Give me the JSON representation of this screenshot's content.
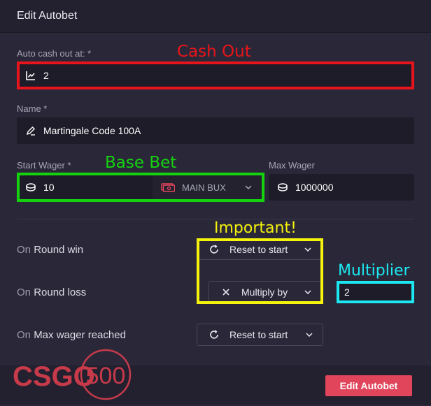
{
  "header": {
    "title": "Edit Autobet"
  },
  "form": {
    "cashout": {
      "label": "Auto cash out at: *",
      "value": "2",
      "icon": "chart-line-icon"
    },
    "name": {
      "label": "Name *",
      "value": "Martingale Code 100A",
      "icon": "pencil-icon"
    },
    "start_wager": {
      "label": "Start Wager *",
      "value": "10",
      "icon": "coin-icon",
      "currency": "MAIN BUX",
      "currency_icon": "cash-stack-icon"
    },
    "max_wager": {
      "label": "Max Wager",
      "value": "1000000",
      "icon": "coin-icon"
    }
  },
  "rules": {
    "round_win": {
      "prefix": "On",
      "event": "Round win",
      "action": "Reset to start",
      "icon": "reset-icon"
    },
    "round_loss": {
      "prefix": "On",
      "event": "Round loss",
      "action": "Multiply by",
      "icon": "times-icon",
      "multiplier": "2"
    },
    "max_wager_reached": {
      "prefix": "On",
      "event": "Max wager reached",
      "action": "Reset to start",
      "icon": "reset-icon"
    }
  },
  "annotations": {
    "cash_out": "Cash Out",
    "base_bet": "Base Bet",
    "important": "Important!",
    "multiplier": "Multiplier"
  },
  "footer": {
    "submit_label": "Edit Autobet",
    "logo_left": "CSGO",
    "logo_right": "500"
  },
  "colors": {
    "red": "#e8141b",
    "green": "#15d20f",
    "yellow": "#f5f20c",
    "cyan": "#1ce8f2",
    "brand": "#e1455b"
  }
}
